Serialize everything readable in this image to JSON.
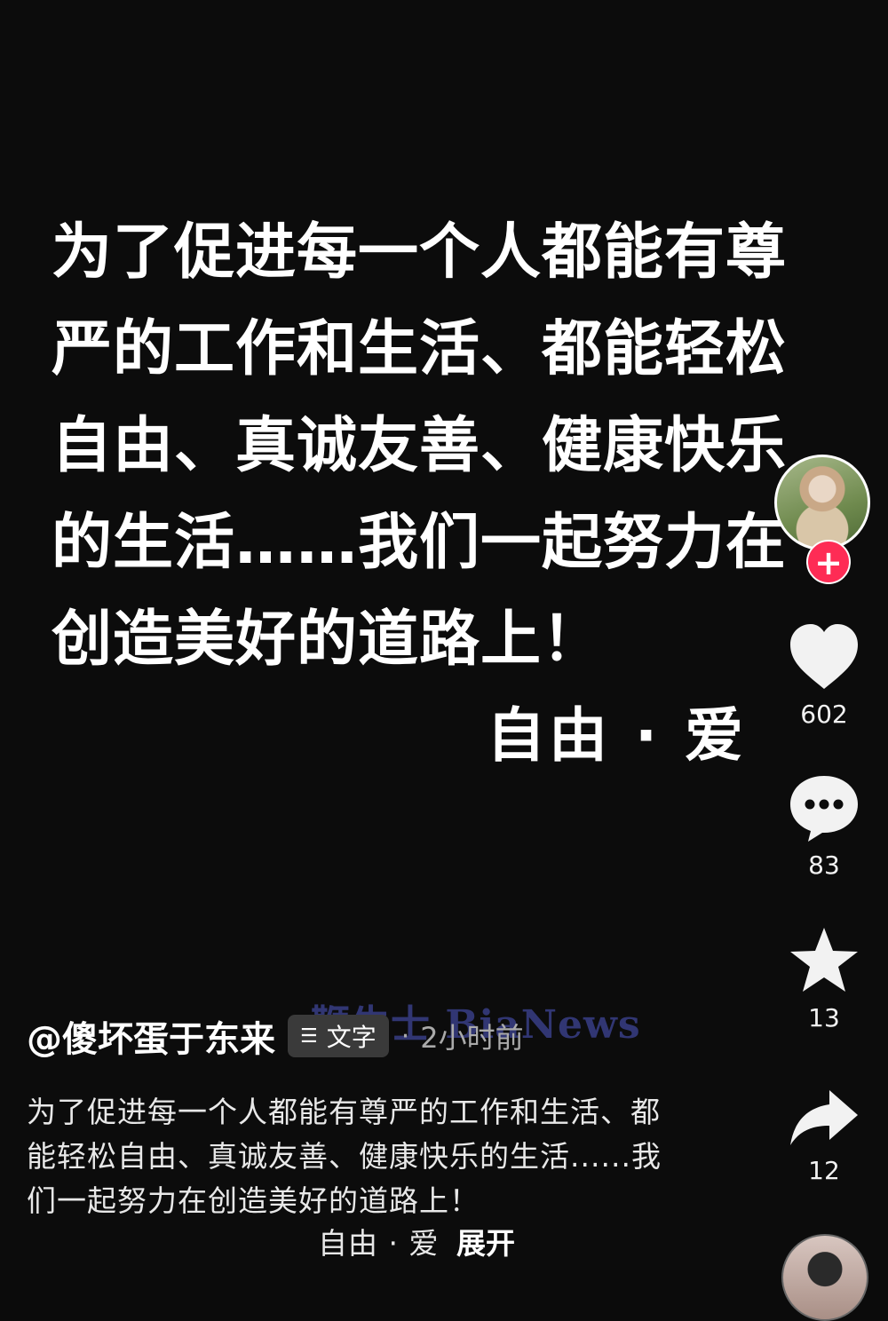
{
  "post": {
    "big_text": "为了促进每一个人都能有尊严的工作和生活、都能轻松自由、真诚友善、健康快乐的生活……我们一起努力在创造美好的道路上！",
    "big_signature": "自由 · 爱"
  },
  "actions": {
    "follow_icon": "plus-icon",
    "likes": "602",
    "comments": "83",
    "favorites": "13",
    "shares": "12"
  },
  "meta": {
    "author": "@傻坏蛋于东来",
    "tag_icon": "text-lines-icon",
    "tag_label": "文字",
    "separator": "·",
    "time": "2小时前",
    "watermark": "鞭牛士 BiaNews"
  },
  "caption": {
    "text": "为了促进每一个人都能有尊严的工作和生活、都能轻松自由、真诚友善、健康快乐的生活......我们一起努力在创造美好的道路上！",
    "tail": "自由 · 爱",
    "expand": "展开"
  },
  "colors": {
    "follow": "#fe2c55",
    "chip_bg": "#3a3a3a",
    "meta_gray": "#aaaaaa"
  }
}
